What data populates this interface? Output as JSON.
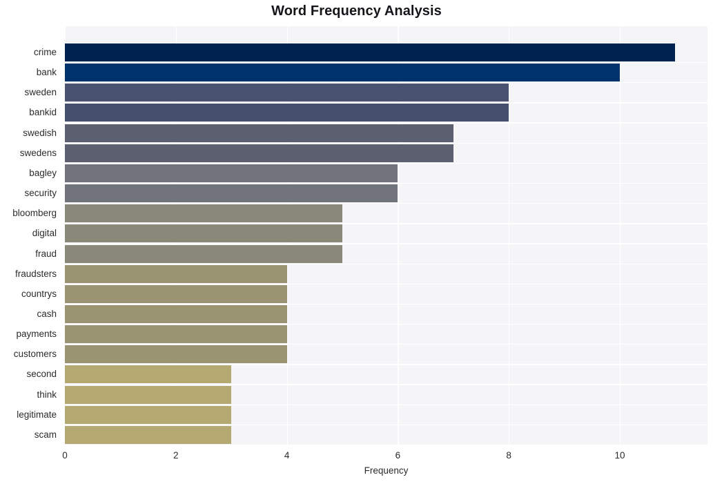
{
  "chart_data": {
    "type": "bar",
    "orientation": "horizontal",
    "title": "Word Frequency Analysis",
    "xlabel": "Frequency",
    "ylabel": "",
    "categories": [
      "crime",
      "bank",
      "sweden",
      "bankid",
      "swedish",
      "swedens",
      "bagley",
      "security",
      "bloomberg",
      "digital",
      "fraud",
      "fraudsters",
      "countrys",
      "cash",
      "payments",
      "customers",
      "second",
      "think",
      "legitimate",
      "scam"
    ],
    "values": [
      11,
      10,
      8,
      8,
      7,
      7,
      6,
      6,
      5,
      5,
      5,
      4,
      4,
      4,
      4,
      4,
      3,
      3,
      3,
      3
    ],
    "bar_colors": [
      "#00224e",
      "#00336b",
      "#4a5271",
      "#454f6e",
      "#5c6070",
      "#5c6070",
      "#71747a",
      "#71747a",
      "#8a8878",
      "#8a8878",
      "#8a8878",
      "#9b9472",
      "#9b9472",
      "#9b9472",
      "#9b9472",
      "#9b9472",
      "#b4a970",
      "#b4a970",
      "#b4a970",
      "#b4a970"
    ],
    "xticks": [
      0,
      2,
      4,
      6,
      8,
      10
    ],
    "xtick_labels": [
      "0",
      "2",
      "4",
      "6",
      "8",
      "10"
    ],
    "xlim": [
      0,
      11.58
    ],
    "grid": true,
    "grid_color": "#ffffff",
    "plot_background": "#f5f5f7",
    "figure_background": "#ffffff",
    "text_color": "#2b2b2b",
    "title_color": "#14161a"
  }
}
